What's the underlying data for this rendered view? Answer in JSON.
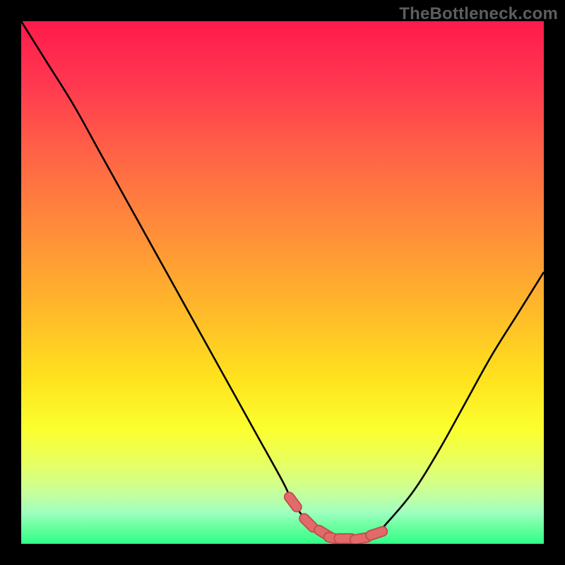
{
  "watermark": {
    "text": "TheBottleneck.com"
  },
  "palette": {
    "gradient_stops": [
      {
        "pct": 0,
        "color": "#ff1a4b"
      },
      {
        "pct": 12,
        "color": "#ff3850"
      },
      {
        "pct": 25,
        "color": "#ff6246"
      },
      {
        "pct": 40,
        "color": "#ff8d3a"
      },
      {
        "pct": 55,
        "color": "#ffb82a"
      },
      {
        "pct": 68,
        "color": "#ffe11e"
      },
      {
        "pct": 78,
        "color": "#fbff2e"
      },
      {
        "pct": 84,
        "color": "#e9ff5d"
      },
      {
        "pct": 88,
        "color": "#d6ff84"
      },
      {
        "pct": 91,
        "color": "#bfffa3"
      },
      {
        "pct": 94,
        "color": "#9fffbe"
      },
      {
        "pct": 97,
        "color": "#66ff9e"
      },
      {
        "pct": 100,
        "color": "#2eff87"
      }
    ],
    "curve_color": "#000000",
    "marker_fill": "#e26a6a",
    "marker_stroke": "#c24d4d",
    "bg": "#000000"
  },
  "chart_data": {
    "type": "line",
    "title": "",
    "xlabel": "",
    "ylabel": "",
    "xlim": [
      0,
      100
    ],
    "ylim": [
      0,
      100
    ],
    "x": [
      0,
      5,
      10,
      15,
      20,
      25,
      30,
      35,
      40,
      45,
      50,
      52,
      55,
      58,
      60,
      62,
      65,
      68,
      70,
      75,
      80,
      85,
      90,
      95,
      100
    ],
    "values": [
      100,
      92,
      84,
      75,
      66,
      57,
      48,
      39,
      30,
      21,
      12,
      8,
      4,
      2,
      1,
      1,
      1,
      2,
      4,
      10,
      18,
      27,
      36,
      44,
      52
    ],
    "markers_x": [
      52,
      55,
      58,
      60,
      62,
      65,
      68
    ],
    "markers_y": [
      8,
      4,
      2,
      1,
      1,
      1,
      2
    ]
  }
}
